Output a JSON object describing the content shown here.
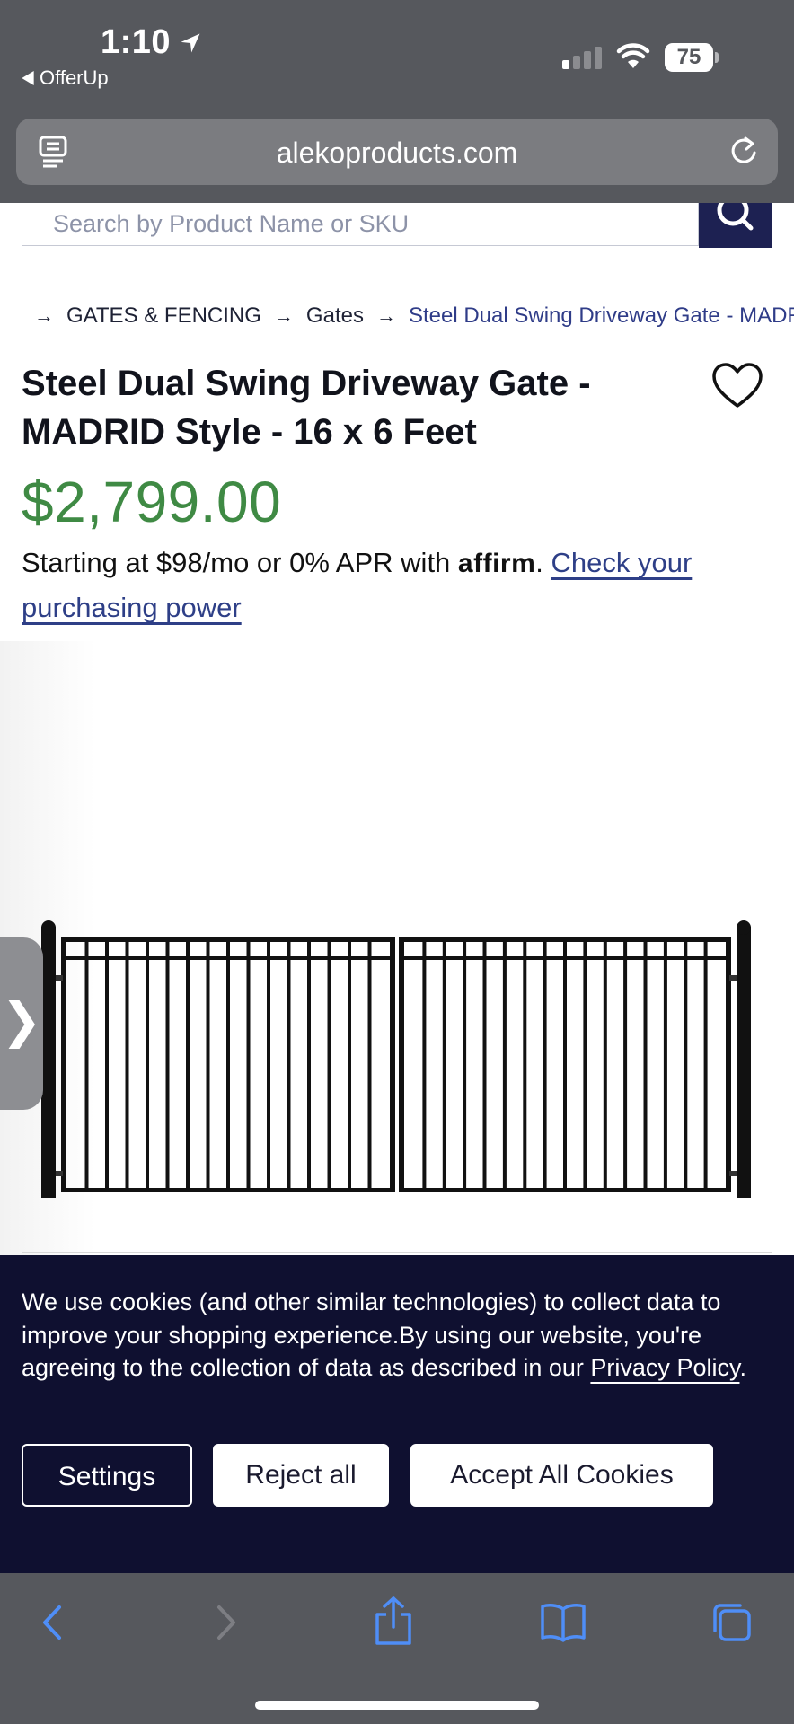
{
  "status": {
    "time": "1:10",
    "back_app": "OfferUp",
    "battery": "75"
  },
  "browser": {
    "url": "alekoproducts.com"
  },
  "search": {
    "placeholder": "Search by Product Name or SKU"
  },
  "breadcrumb": {
    "items": [
      "GATES & FENCING",
      "Gates"
    ],
    "current": "Steel Dual Swing Driveway Gate - MADR"
  },
  "product": {
    "title": "Steel Dual Swing Driveway Gate - MADRID Style - 16 x 6 Feet",
    "price": "$2,799.00",
    "financing_prefix": "Starting at $98/mo or 0% APR with",
    "affirm": "affirm",
    "financing_link": "Check your purchasing power"
  },
  "gallery": {
    "next_glyph": "❯"
  },
  "cookie_banner": {
    "text": "We use cookies (and other similar technologies) to collect data to improve your shopping experience.By using our website, you're agreeing to the collection of data as described in our",
    "policy_link": "Privacy Policy",
    "settings_label": "Settings",
    "reject_label": "Reject all",
    "accept_label": "Accept All Cookies"
  },
  "colors": {
    "price_green": "#3f8a44",
    "navy": "#1d2152",
    "link_blue": "#2e3f87",
    "cookie_bg": "#0f1030",
    "safari_gray": "#56585d"
  }
}
